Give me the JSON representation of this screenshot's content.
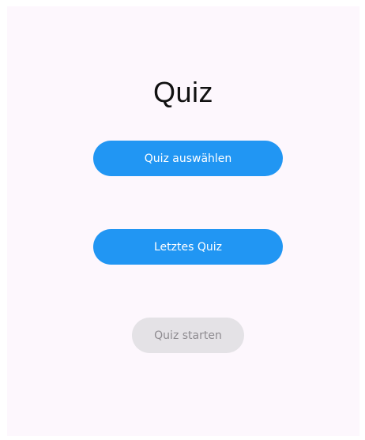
{
  "screen": {
    "title": "Quiz",
    "buttons": {
      "select_quiz": "Quiz auswählen",
      "last_quiz": "Letztes Quiz",
      "start_quiz": "Quiz starten"
    },
    "colors": {
      "background": "#fdf7fd",
      "primary": "#2196f3",
      "primary_text": "#ffffff",
      "disabled": "#e4e2e6",
      "disabled_text": "#8e8b90"
    },
    "start_quiz_enabled": false
  }
}
